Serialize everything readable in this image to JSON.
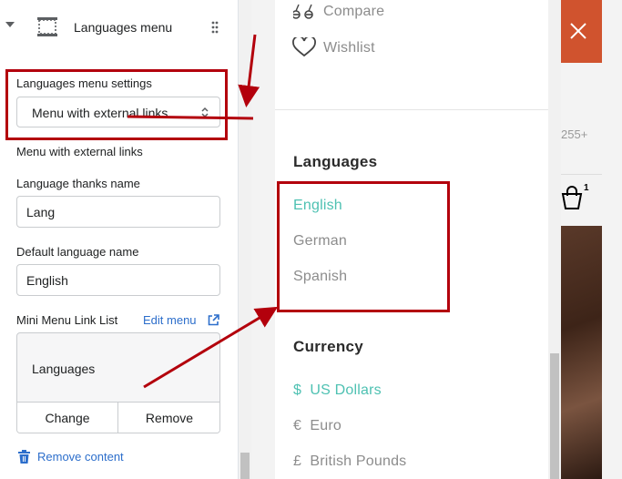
{
  "section": {
    "title": "Languages menu"
  },
  "settings": {
    "group_label": "Languages menu settings",
    "menu_select": {
      "value": "Menu with external links"
    },
    "select_help": "Menu with external links",
    "thanks_name": {
      "label": "Language thanks name",
      "value": "Lang"
    },
    "default_language": {
      "label": "Default language name",
      "value": "English"
    },
    "link_list": {
      "label": "Mini Menu Link List",
      "edit_label": "Edit menu",
      "selected_menu": "Languages",
      "change_label": "Change",
      "remove_label": "Remove"
    },
    "remove_content_label": "Remove content"
  },
  "drawer": {
    "top_links": [
      "Compare",
      "Wishlist"
    ],
    "languages": {
      "heading": "Languages",
      "items": [
        "English",
        "German",
        "Spanish"
      ],
      "active_index": 0
    },
    "currency": {
      "heading": "Currency",
      "items": [
        {
          "symbol": "$",
          "label": "US Dollars"
        },
        {
          "symbol": "€",
          "label": "Euro"
        },
        {
          "symbol": "£",
          "label": "British Pounds"
        }
      ],
      "active_index": 0
    }
  },
  "background": {
    "partial_number": "255+",
    "cart_count": "1"
  },
  "colors": {
    "accent_teal": "#4ec1b2",
    "annotation_red": "#b3000c",
    "link_blue": "#2c6ecb",
    "header_orange": "#d0532e"
  },
  "icons": [
    "caret-down-icon",
    "section-block-icon",
    "drag-handle-icon",
    "select-arrows-icon",
    "external-link-icon",
    "trash-icon",
    "compare-icon",
    "heart-icon",
    "close-icon",
    "shopping-bag-icon"
  ]
}
